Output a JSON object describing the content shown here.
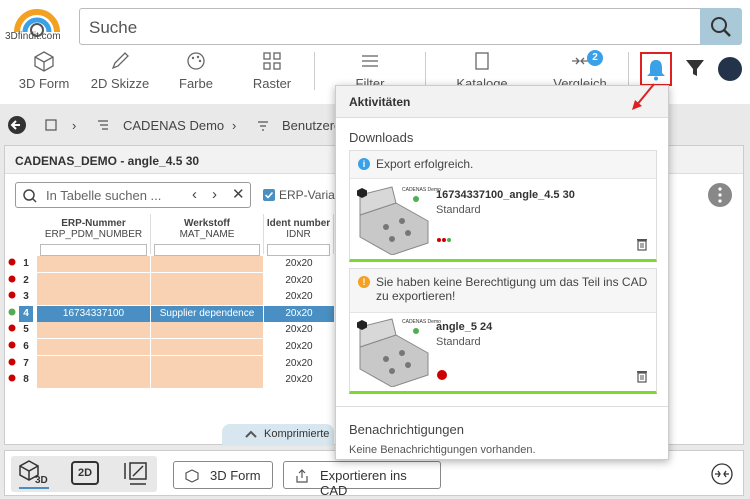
{
  "logo": {
    "text": "3Dfindit.com"
  },
  "search": {
    "placeholder": "Suche"
  },
  "toolbar": {
    "form3d": "3D Form",
    "sketch2d": "2D Skizze",
    "color": "Farbe",
    "grid": "Raster",
    "filter": "Filter",
    "catalogs": "Kataloge",
    "compare": "Vergleich",
    "compare_count": "2"
  },
  "breadcrumb": {
    "item1": "CADENAS Demo",
    "item2": "Benutzerd"
  },
  "panel": {
    "title": "CADENAS_DEMO - angle_4.5 30",
    "table_search_placeholder": "In Tabelle suchen ...",
    "erp_var_label": "ERP-Variab"
  },
  "table": {
    "columns": [
      {
        "name": "ERP-Nummer",
        "sub": "ERP_PDM_NUMBER"
      },
      {
        "name": "Werkstoff",
        "sub": "MAT_NAME"
      },
      {
        "name": "Ident number",
        "sub": "IDNR"
      }
    ],
    "rows": [
      {
        "num": "1",
        "erp": "",
        "mat": "",
        "id": "20x20"
      },
      {
        "num": "2",
        "erp": "",
        "mat": "",
        "id": "20x20"
      },
      {
        "num": "3",
        "erp": "",
        "mat": "",
        "id": "20x20"
      },
      {
        "num": "4",
        "erp": "16734337100",
        "mat": "Supplier dependence",
        "id": "20x20",
        "selected": true
      },
      {
        "num": "5",
        "erp": "",
        "mat": "",
        "id": "20x20"
      },
      {
        "num": "6",
        "erp": "",
        "mat": "",
        "id": "20x20"
      },
      {
        "num": "7",
        "erp": "",
        "mat": "",
        "id": "20x20"
      },
      {
        "num": "8",
        "erp": "",
        "mat": "",
        "id": "20x20"
      }
    ],
    "compress_label": "Komprimierte"
  },
  "popup": {
    "title": "Aktivitäten",
    "downloads_title": "Downloads",
    "cards": [
      {
        "message": "Export erfolgreich.",
        "status": "info",
        "part_name": "16734337100_angle_4.5 30",
        "variant": "Standard",
        "thumb_label": "CADENAS Demo"
      },
      {
        "message": "Sie haben keine Berechtigung um das Teil ins CAD zu exportieren!",
        "status": "warning",
        "part_name": "angle_5 24",
        "variant": "Standard",
        "thumb_label": "CADENAS Demo"
      }
    ],
    "notifications_title": "Benachrichtigungen",
    "notifications_empty": "Keine Benachrichtigungen vorhanden."
  },
  "bottombar": {
    "view3d": "3D",
    "view2d": "2D",
    "form3d_button": "3D Form",
    "export_button": "Exportieren ins CAD"
  },
  "colors": {
    "accent": "#3aa0e8",
    "selected_row": "#4a8fc3",
    "erp_cell": "#f9d1b3",
    "success": "#7cd92e",
    "highlight_border": "#e02020"
  }
}
